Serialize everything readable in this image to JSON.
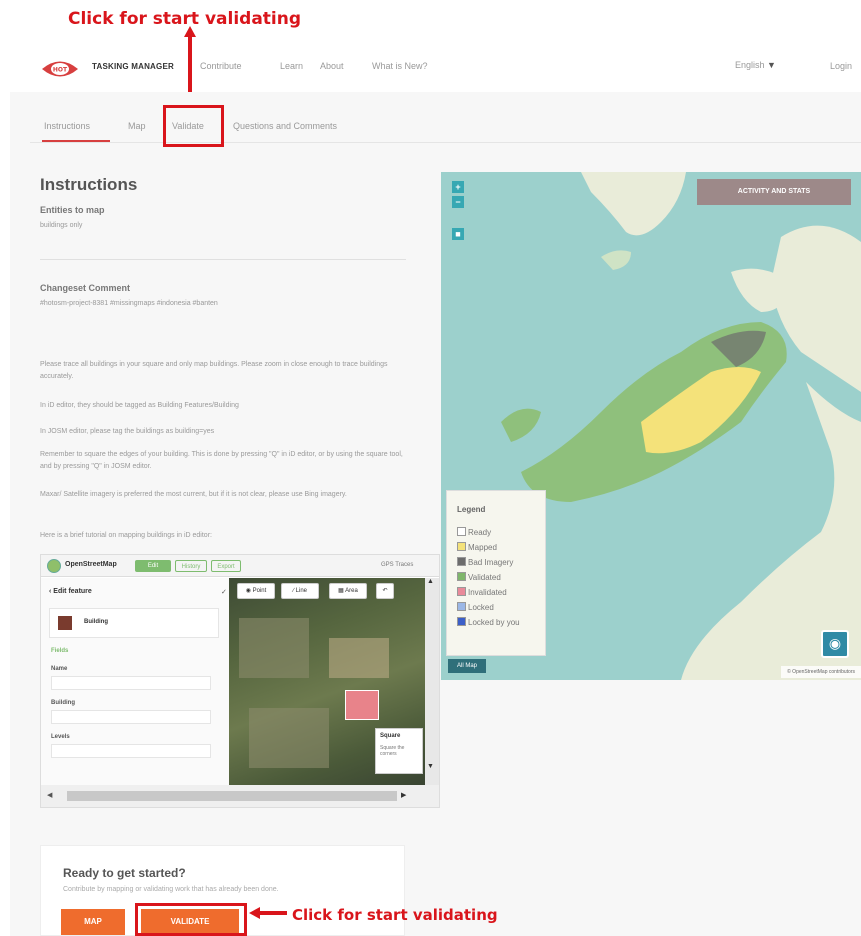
{
  "annotations": {
    "top_callout": "Click for start validating",
    "bottom_callout": "Click for start validating"
  },
  "header": {
    "brand": "TASKING MANAGER",
    "nav": [
      "Contribute",
      "Learn",
      "About",
      "What is New?"
    ],
    "language": "English",
    "login": "Login"
  },
  "tabs": [
    "Instructions",
    "Map",
    "Validate",
    "Questions and Comments"
  ],
  "instructions": {
    "title": "Instructions",
    "entities_heading": "Entities to map",
    "entities_value": "buildings only",
    "changeset_heading": "Changeset Comment",
    "changeset_value": "#hotosm-project-8381 #missingmaps #indonesia #banten",
    "paragraphs": [
      "Please trace all buildings in your square and only map buildings. Please zoom in close enough to trace buildings accurately.",
      "In iD editor, they should be tagged as Building Features/Building",
      "In JOSM editor, please tag the buildings as building=yes",
      "Remember to square the edges of your building. This is done by pressing \"Q\" in iD editor, or by using the square tool, and by pressing \"Q\" in JOSM editor.",
      "Maxar/ Satellite imagery is preferred the most current, but if it is not clear, please use Bing imagery.",
      "Here is a brief tutorial on mapping buildings in iD editor:"
    ]
  },
  "osm_shot": {
    "name": "OpenStreetMap",
    "edit": "Edit",
    "history": "History",
    "export": "Export",
    "status": "GPS Traces",
    "edit_feature": "Edit feature",
    "preset": "Building",
    "fields_label": "Fields",
    "field_name": "Name",
    "field_building": "Building",
    "field_levels": "Levels",
    "tool_point": "Point",
    "tool_line": "Line",
    "tool_area": "Area",
    "panel_square": "Square",
    "panel_square_sub": "Square the corners"
  },
  "ready": {
    "title": "Ready to get started?",
    "text": "Contribute by mapping or validating work that has already been done.",
    "map_button": "MAP",
    "validate_button": "VALIDATE"
  },
  "map": {
    "activity_button": "ACTIVITY AND STATS",
    "zoom_in": "+",
    "zoom_out": "−",
    "legend_title": "Legend",
    "legend_items": [
      {
        "label": "Ready",
        "color": "#ffffff"
      },
      {
        "label": "Mapped",
        "color": "#f4e27a"
      },
      {
        "label": "Bad Imagery",
        "color": "#6c6c6c"
      },
      {
        "label": "Validated",
        "color": "#7fb66b"
      },
      {
        "label": "Invalidated",
        "color": "#e98a9a"
      },
      {
        "label": "Locked",
        "color": "#9bb7e6"
      },
      {
        "label": "Locked by you",
        "color": "#3c5fc8"
      }
    ],
    "all_button": "All Map",
    "attribution": "© OpenStreetMap contributors",
    "colors": {
      "sea": "#9cd0cc",
      "land": "#e9ecd9",
      "accent": "#d73f3f",
      "orange": "#ef6c2d"
    }
  }
}
